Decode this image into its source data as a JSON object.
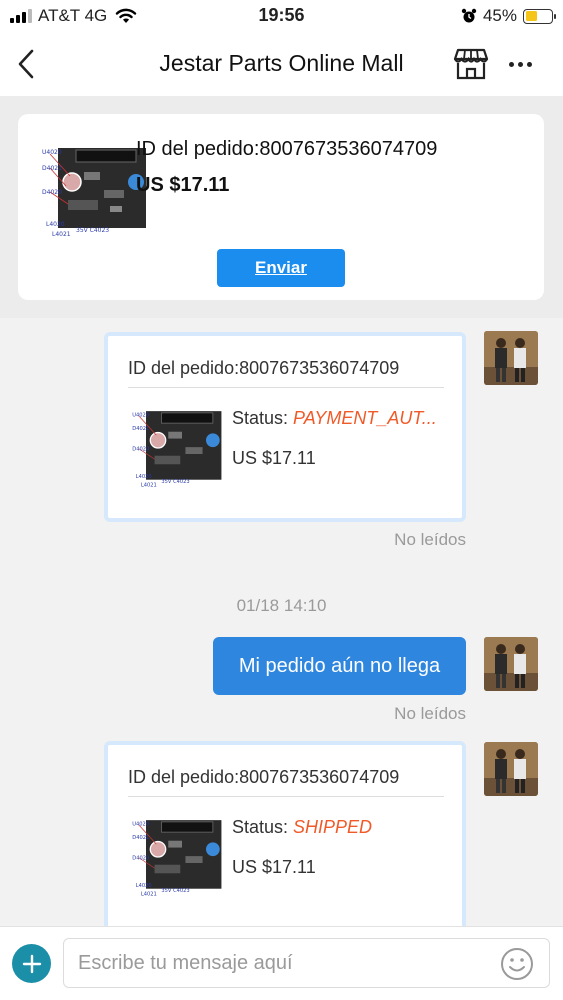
{
  "status_bar": {
    "carrier": "AT&T 4G",
    "time": "19:56",
    "battery_percent": "45%",
    "battery_level": 0.45,
    "icons": [
      "signal-icon",
      "wifi-icon",
      "alarm-icon",
      "battery-icon"
    ]
  },
  "header": {
    "title": "Jestar Parts Online Mall",
    "icons": [
      "back-chevron-icon",
      "store-icon",
      "more-dots-icon"
    ]
  },
  "pinned_order": {
    "order_id_label": "ID del pedido:8007673536074709",
    "price": "US $17.11",
    "send_button": "Enviar",
    "thumb_labels": [
      "U4020",
      "D4021",
      "D4020",
      "L4020",
      "L4021",
      "35V C4023"
    ]
  },
  "messages": {
    "order_message_1": {
      "order_id_label": "ID del pedido:8007673536074709",
      "status_label": "Status: ",
      "status_value": "PAYMENT_AUT...",
      "price": "US $17.11",
      "read_state": "No leídos"
    },
    "timestamp": "01/18 14:10",
    "text_message": {
      "text": "Mi pedido aún no llega",
      "read_state": "No leídos"
    },
    "order_message_2": {
      "order_id_label": "ID del pedido:8007673536074709",
      "status_label": "Status: ",
      "status_value": "SHIPPED",
      "price": "US $17.11"
    }
  },
  "input_bar": {
    "placeholder": "Escribe tu mensaje aquí",
    "value": "",
    "icons": [
      "plus-icon",
      "emoji-icon"
    ]
  },
  "colors": {
    "accent_blue": "#1a8dee",
    "bubble_blue": "#2e86de",
    "status_orange": "#f05a28",
    "add_button": "#1b8fa8"
  }
}
